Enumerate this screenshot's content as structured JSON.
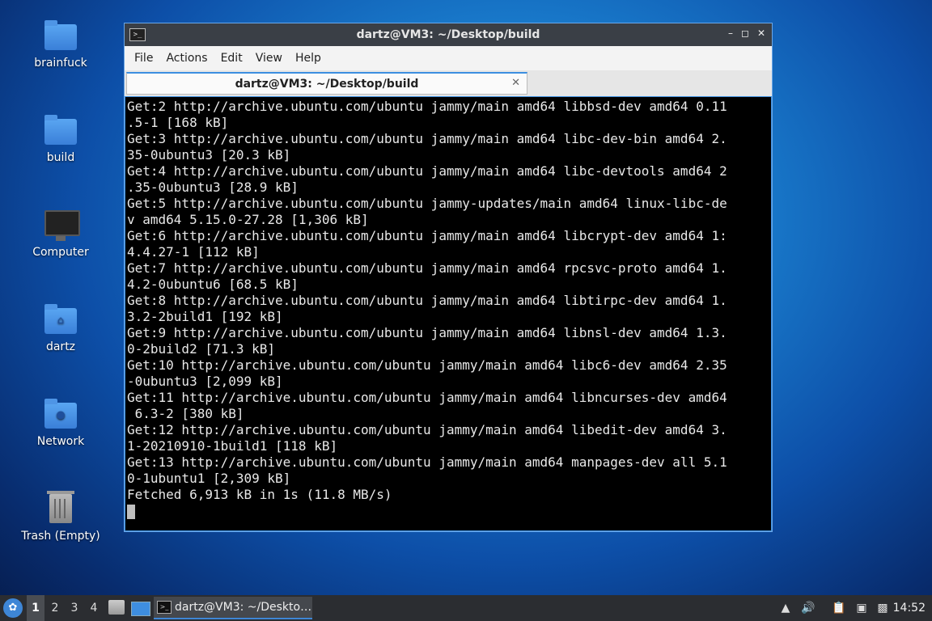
{
  "desktop": {
    "icons": [
      {
        "label": "brainfuck"
      },
      {
        "label": "build"
      },
      {
        "label": "Computer"
      },
      {
        "label": "dartz"
      },
      {
        "label": "Network"
      },
      {
        "label": "Trash (Empty)"
      }
    ]
  },
  "window": {
    "title": "dartz@VM3: ~/Desktop/build",
    "app_icon": ">_",
    "controls": {
      "minimize": "–",
      "maximize": "◻",
      "close": "✕"
    },
    "menu": [
      "File",
      "Actions",
      "Edit",
      "View",
      "Help"
    ],
    "tab": {
      "label": "dartz@VM3: ~/Desktop/build",
      "close": "✕"
    },
    "terminal_lines": [
      "Get:2 http://archive.ubuntu.com/ubuntu jammy/main amd64 libbsd-dev amd64 0.11",
      ".5-1 [168 kB]",
      "Get:3 http://archive.ubuntu.com/ubuntu jammy/main amd64 libc-dev-bin amd64 2.",
      "35-0ubuntu3 [20.3 kB]",
      "Get:4 http://archive.ubuntu.com/ubuntu jammy/main amd64 libc-devtools amd64 2",
      ".35-0ubuntu3 [28.9 kB]",
      "Get:5 http://archive.ubuntu.com/ubuntu jammy-updates/main amd64 linux-libc-de",
      "v amd64 5.15.0-27.28 [1,306 kB]",
      "Get:6 http://archive.ubuntu.com/ubuntu jammy/main amd64 libcrypt-dev amd64 1:",
      "4.4.27-1 [112 kB]",
      "Get:7 http://archive.ubuntu.com/ubuntu jammy/main amd64 rpcsvc-proto amd64 1.",
      "4.2-0ubuntu6 [68.5 kB]",
      "Get:8 http://archive.ubuntu.com/ubuntu jammy/main amd64 libtirpc-dev amd64 1.",
      "3.2-2build1 [192 kB]",
      "Get:9 http://archive.ubuntu.com/ubuntu jammy/main amd64 libnsl-dev amd64 1.3.",
      "0-2build2 [71.3 kB]",
      "Get:10 http://archive.ubuntu.com/ubuntu jammy/main amd64 libc6-dev amd64 2.35",
      "-0ubuntu3 [2,099 kB]",
      "Get:11 http://archive.ubuntu.com/ubuntu jammy/main amd64 libncurses-dev amd64",
      " 6.3-2 [380 kB]",
      "Get:12 http://archive.ubuntu.com/ubuntu jammy/main amd64 libedit-dev amd64 3.",
      "1-20210910-1build1 [118 kB]",
      "Get:13 http://archive.ubuntu.com/ubuntu jammy/main amd64 manpages-dev all 5.1",
      "0-1ubuntu1 [2,309 kB]",
      "Fetched 6,913 kB in 1s (11.8 MB/s)"
    ]
  },
  "taskbar": {
    "workspaces": [
      "1",
      "2",
      "3",
      "4"
    ],
    "task_label": "dartz@VM3: ~/Deskto…",
    "clock": "14:52"
  }
}
